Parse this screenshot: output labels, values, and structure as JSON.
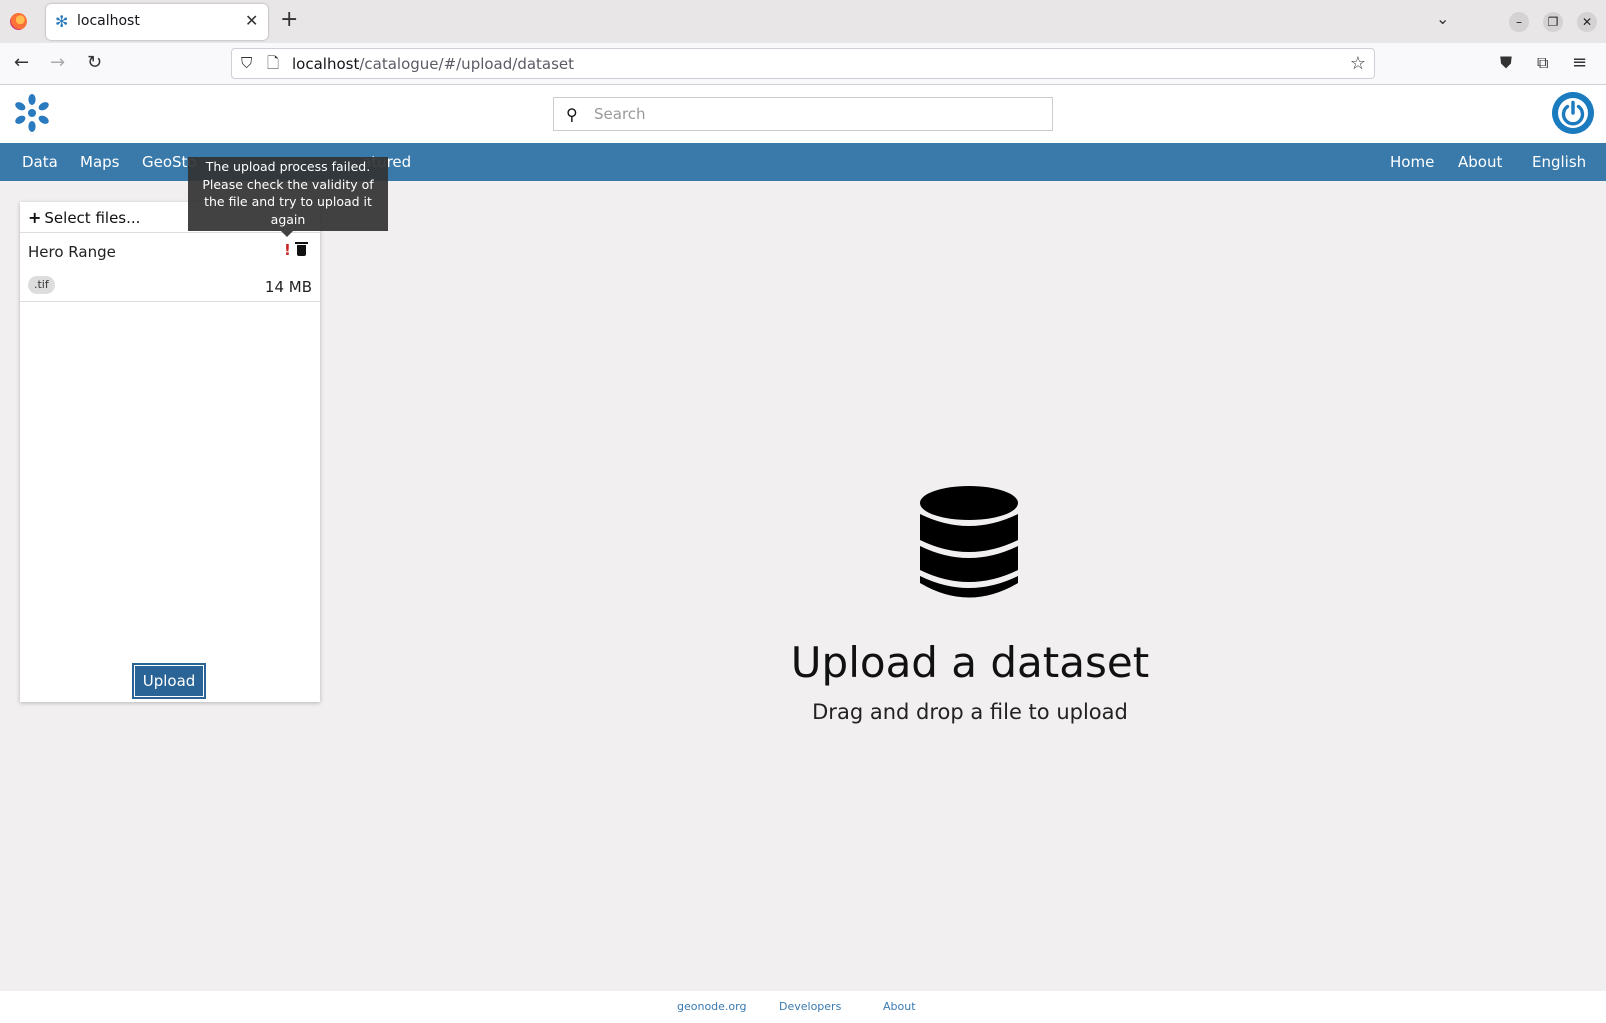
{
  "browser": {
    "tab_title": "localhost",
    "tab_favicon": "geonode-asterisk-icon",
    "url_host": "localhost",
    "url_path": "/catalogue/#/upload/dataset"
  },
  "header": {
    "search_placeholder": "Search"
  },
  "menu": {
    "left": [
      "Data",
      "Maps",
      "GeoSto",
      "atured"
    ],
    "right": [
      "Home",
      "About",
      "English"
    ]
  },
  "upload_panel": {
    "select_files_label": "Select files...",
    "file": {
      "name": "Hero Range",
      "extension": ".tif",
      "size": "14 MB",
      "status": "error"
    },
    "upload_label": "Upload"
  },
  "tooltip": {
    "text": "The upload process failed. Please check the validity of the file and try to upload it again"
  },
  "dropzone": {
    "title": "Upload a dataset",
    "subtitle": "Drag and drop a file to upload",
    "icon": "database-icon"
  },
  "footer": {
    "links": [
      "geonode.org",
      "Developers",
      "About"
    ]
  },
  "colors": {
    "menubar": "#397aab",
    "brand": "#1a7bbf",
    "upload_button": "#2a6496",
    "error": "#c62828"
  }
}
